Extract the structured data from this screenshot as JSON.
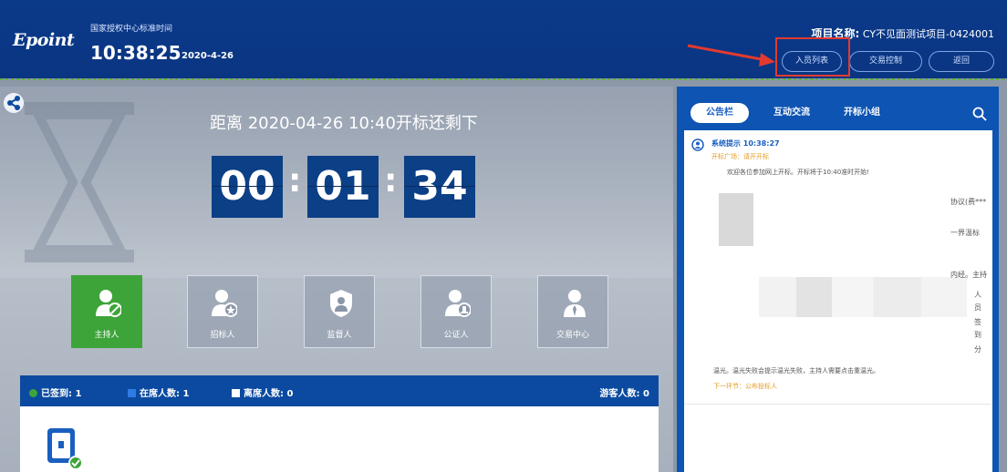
{
  "header": {
    "logo": "Epoint",
    "center_name": "国家授权中心标准时间",
    "clock_time": "10:38:25",
    "clock_date": "2020-4-26",
    "project_label": "项目名称:",
    "project_name": "CY不见面测试项目-0424001",
    "buttons": {
      "members": "入员列表",
      "trade_control": "交易控制",
      "return": "返回"
    }
  },
  "countdown": {
    "title": "距离 2020-04-26 10:40开标还剩下",
    "hours": "00",
    "minutes": "01",
    "seconds": "34",
    "separator": ":"
  },
  "roles": [
    {
      "label": "主持人",
      "icon": "host-icon",
      "active": true
    },
    {
      "label": "招标人",
      "icon": "tenderer-icon",
      "active": false
    },
    {
      "label": "监督人",
      "icon": "supervisor-icon",
      "active": false
    },
    {
      "label": "公证人",
      "icon": "notary-icon",
      "active": false
    },
    {
      "label": "交易中心",
      "icon": "trade-center-icon",
      "active": false
    }
  ],
  "stats": {
    "signed": "已签到: 1",
    "online": "在席人数: 1",
    "offline": "离席人数: 0",
    "guests": "游客人数: 0"
  },
  "chat": {
    "tabs": [
      "公告栏",
      "互动交流",
      "开标小组"
    ],
    "active_tab": 0,
    "message": {
      "sender_time": "系统提示 10:38:27",
      "tag": "开标广场：请开开标",
      "line1": "欢迎各位参加网上开标。开标将于10:40准时开始!",
      "line2": "温光。温光失败会提示温光失败，主持人需要点击重温光。",
      "next": "下一环节：公布投标人"
    },
    "fragments": [
      "协议(费***",
      "一界温标",
      "内经。主持"
    ],
    "vertical_fragments": [
      "人",
      "员",
      "签",
      "到",
      "分"
    ]
  },
  "colors": {
    "header_bg": "#0b3a8a",
    "accent_blue": "#0e54b3",
    "active_green": "#3da43a",
    "highlight_red": "#e23a2f",
    "tag_orange": "#e29b24"
  }
}
